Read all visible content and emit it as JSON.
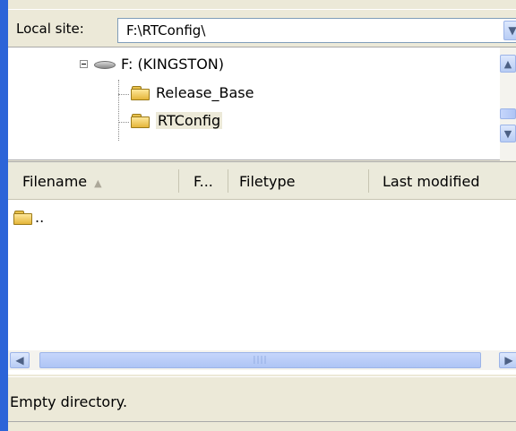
{
  "local_site": {
    "label": "Local site:",
    "path": "F:\\RTConfig\\",
    "dropdown_icon": "chevron-down-icon"
  },
  "tree": {
    "items": [
      {
        "label": "F: (KINGSTON)",
        "icon": "drive-icon"
      },
      {
        "label": "Release_Base",
        "icon": "folder-icon"
      },
      {
        "label": "RTConfig",
        "icon": "folder-icon",
        "selected": true
      }
    ]
  },
  "file_list": {
    "columns": [
      {
        "label": "Filename",
        "sorted": "ascending"
      },
      {
        "label": "F..."
      },
      {
        "label": "Filetype"
      },
      {
        "label": "Last modified"
      }
    ],
    "rows": [
      {
        "name": "..",
        "icon": "folder-icon"
      }
    ]
  },
  "status": {
    "text": "Empty directory."
  },
  "colors": {
    "window_border": "#2c64d8",
    "panel_background": "#ece9d8",
    "scrollbar_blue": "#b7ccf4"
  }
}
